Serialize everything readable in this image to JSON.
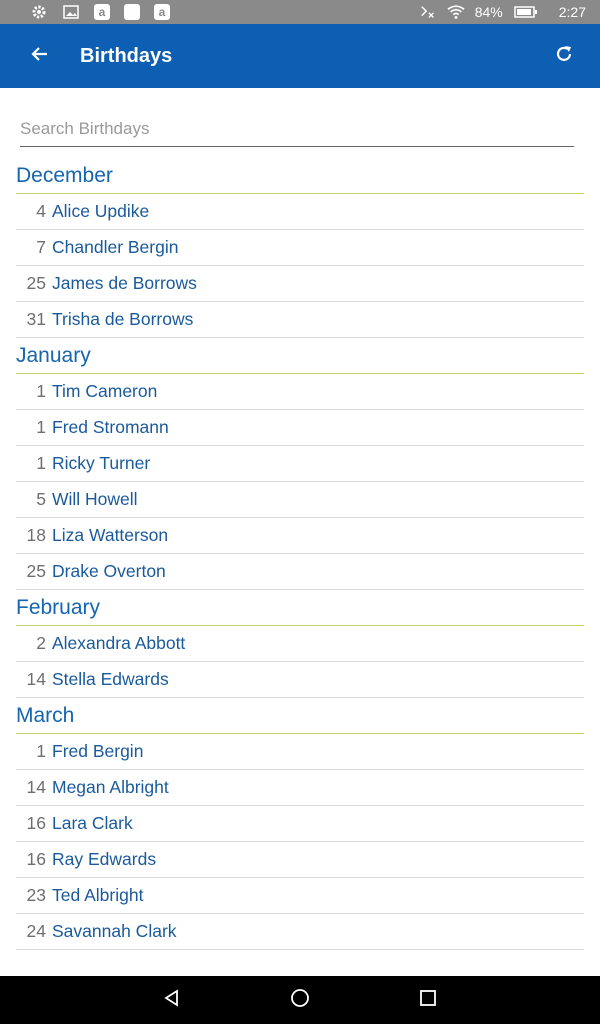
{
  "status_bar": {
    "battery": "84%",
    "time": "2:27",
    "icons": [
      "gear-icon",
      "image-icon",
      "amazon-icon",
      "square-icon",
      "amazon-icon",
      "bluetooth-off-icon",
      "wifi-icon",
      "battery-icon"
    ]
  },
  "app_bar": {
    "title": "Birthdays",
    "back_icon": "arrow-left-icon",
    "refresh_icon": "refresh-icon",
    "background": "#0d5fb3"
  },
  "search": {
    "placeholder": "Search Birthdays",
    "value": ""
  },
  "months": [
    {
      "name": "December",
      "entries": [
        {
          "day": "4",
          "name": "Alice Updike"
        },
        {
          "day": "7",
          "name": "Chandler Bergin"
        },
        {
          "day": "25",
          "name": "James de Borrows"
        },
        {
          "day": "31",
          "name": "Trisha de Borrows"
        }
      ]
    },
    {
      "name": "January",
      "entries": [
        {
          "day": "1",
          "name": "Tim Cameron"
        },
        {
          "day": "1",
          "name": "Fred Stromann"
        },
        {
          "day": "1",
          "name": "Ricky Turner"
        },
        {
          "day": "5",
          "name": "Will Howell"
        },
        {
          "day": "18",
          "name": "Liza Watterson"
        },
        {
          "day": "25",
          "name": "Drake Overton"
        }
      ]
    },
    {
      "name": "February",
      "entries": [
        {
          "day": "2",
          "name": "Alexandra Abbott"
        },
        {
          "day": "14",
          "name": "Stella Edwards"
        }
      ]
    },
    {
      "name": "March",
      "entries": [
        {
          "day": "1",
          "name": "Fred Bergin"
        },
        {
          "day": "14",
          "name": "Megan Albright"
        },
        {
          "day": "16",
          "name": "Lara Clark"
        },
        {
          "day": "16",
          "name": "Ray Edwards"
        },
        {
          "day": "23",
          "name": "Ted Albright"
        },
        {
          "day": "24",
          "name": "Savannah Clark"
        }
      ]
    }
  ],
  "nav_bar": {
    "icons": [
      "back-triangle-icon",
      "home-circle-icon",
      "recents-square-icon"
    ]
  },
  "colors": {
    "month_text": "#1565b0",
    "month_divider": "#c7d36a",
    "name_text": "#1a5a9c",
    "day_text": "#6f6f6f"
  }
}
